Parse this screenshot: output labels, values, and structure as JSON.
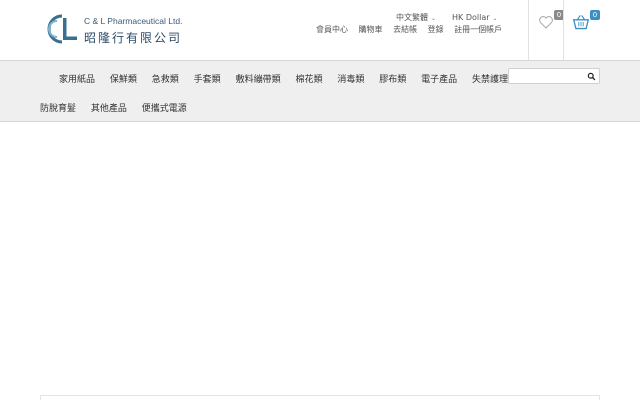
{
  "brand": {
    "name_en": "C & L Pharmaceutical Ltd.",
    "name_zh": "昭隆行有限公司"
  },
  "header": {
    "language": "中文繁體",
    "currency": "HK Dollar",
    "links": [
      "會員中心",
      "購物車",
      "去結帳",
      "登錄",
      "註冊一個帳戶"
    ],
    "wishlist_count": "0",
    "cart_count": "0"
  },
  "nav": {
    "row1": [
      "家用紙品",
      "保鮮類",
      "急救類",
      "手套類",
      "敷料繃帶類",
      "棉花類",
      "消毒類",
      "膠布類",
      "電子產品",
      "失禁護理"
    ],
    "row2": [
      "防脫育髮",
      "其他產品",
      "便攜式電源"
    ]
  },
  "search": {
    "placeholder": ""
  },
  "colors": {
    "nav_bg": "#efefef",
    "accent": "#3b8fc4"
  }
}
